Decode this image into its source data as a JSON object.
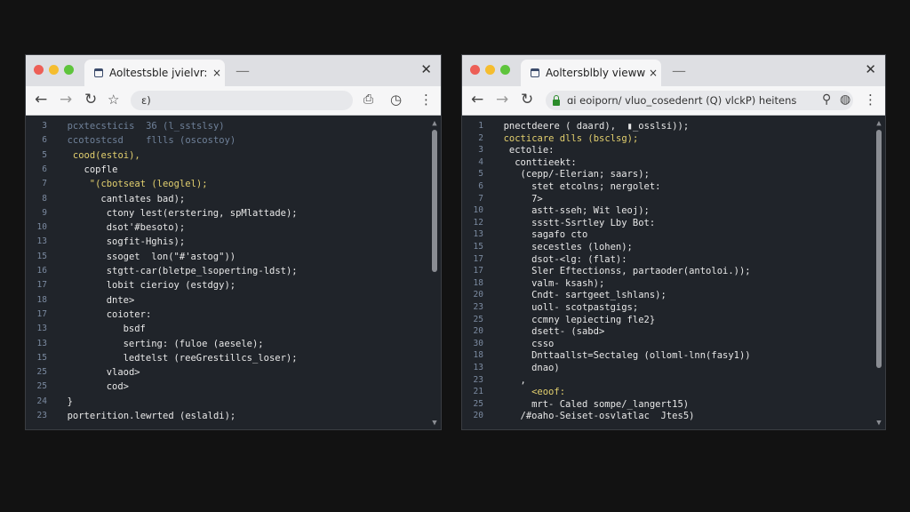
{
  "left": {
    "tab_title": "Aoltestsble jvielvr:",
    "tab_close": "×",
    "new_tab": "—",
    "window_close": "✕",
    "url": "ɛ)",
    "colors": {
      "code_text": "#e8e8e8",
      "line_number": "#7b8aa0",
      "accent_green": "#b7d36a",
      "accent_yellow": "#e2cf6e"
    },
    "lines": [
      {
        "num": "3",
        "text": "pcxtecsticis  36 (l_sstslsy)",
        "color": "dim",
        "indent": 2
      },
      {
        "num": "6",
        "text": "ccotostcsd    fllls (oscostoy)",
        "color": "dim",
        "indent": 2
      },
      {
        "num": "5",
        "text": "cood(estoi),",
        "color": "yellow",
        "indent": 3
      },
      {
        "num": "6",
        "text": "copfle",
        "color": "white",
        "indent": 5
      },
      {
        "num": "7",
        "text": "\"(cbotseat (leoglel);",
        "color": "yellow",
        "indent": 6
      },
      {
        "num": "8",
        "text": "cantlates bad);",
        "color": "white",
        "indent": 8
      },
      {
        "num": "9",
        "text": "ctony lest(erstering, spMlattade);",
        "color": "white",
        "indent": 9
      },
      {
        "num": "10",
        "text": "dsot'#besoto);",
        "color": "white",
        "indent": 9
      },
      {
        "num": "13",
        "text": "sogfit-Hghis);",
        "color": "white",
        "indent": 9
      },
      {
        "num": "15",
        "text": "ssoget  lon(\"#'astog\"))",
        "color": "white",
        "indent": 9
      },
      {
        "num": "16",
        "text": "stgtt-car(bletpe_lsoperting-ldst);",
        "color": "white",
        "indent": 9
      },
      {
        "num": "17",
        "text": "lobit cierioy (estdgy);",
        "color": "white",
        "indent": 9
      },
      {
        "num": "18",
        "text": "dnte>",
        "color": "white",
        "indent": 9
      },
      {
        "num": "17",
        "text": "coioter:",
        "color": "white",
        "indent": 9
      },
      {
        "num": "13",
        "text": "bsdf",
        "color": "white",
        "indent": 12
      },
      {
        "num": "13",
        "text": "serting: (fuloe (aesele);",
        "color": "white",
        "indent": 12
      },
      {
        "num": "15",
        "text": "ledtelst (reeGrestillcs_loser);",
        "color": "white",
        "indent": 12
      },
      {
        "num": "25",
        "text": "vlaod>",
        "color": "white",
        "indent": 9
      },
      {
        "num": "25",
        "text": "cod>",
        "color": "white",
        "indent": 9
      },
      {
        "num": "24",
        "text": "}",
        "color": "white",
        "indent": 2
      },
      {
        "num": "23",
        "text": "porterition.lewrted (eslaldi);",
        "color": "white",
        "indent": 2
      }
    ]
  },
  "right": {
    "tab_title": "Aoltersblbly vieww:",
    "tab_close": "×",
    "new_tab": "—",
    "window_close": "✕",
    "url": "ɑi eoiporn/ vluo_cosedenrt (Q) vlckP) heitens",
    "colors": {
      "code_text": "#e8e8e8",
      "line_number": "#7b8aa0",
      "accent_green": "#b7d36a",
      "accent_yellow": "#e2cf6e"
    },
    "lines": [
      {
        "num": "1",
        "text": "pnectdeere ( daard),  ▮_osslsi));",
        "color": "white",
        "indent": 2
      },
      {
        "num": "2",
        "text": "cocticare dlls (bsclsg);",
        "color": "yellow",
        "indent": 2
      },
      {
        "num": "3",
        "text": "ectolie:",
        "color": "white",
        "indent": 3
      },
      {
        "num": "4",
        "text": "conttieekt:",
        "color": "white",
        "indent": 4
      },
      {
        "num": "5",
        "text": "(cepp/-Elerian; saars);",
        "color": "white",
        "indent": 5
      },
      {
        "num": "6",
        "text": "stet etcolns; nergolet:",
        "color": "white",
        "indent": 7
      },
      {
        "num": "7",
        "text": "7>",
        "color": "white",
        "indent": 7
      },
      {
        "num": "10",
        "text": "astt-sseh; Wit leoj);",
        "color": "white",
        "indent": 7
      },
      {
        "num": "12",
        "text": "ssstt-Ssrtley Lby Bot:",
        "color": "white",
        "indent": 7
      },
      {
        "num": "13",
        "text": "sagafo cto",
        "color": "white",
        "indent": 7
      },
      {
        "num": "15",
        "text": "secestles (lohen);",
        "color": "white",
        "indent": 7
      },
      {
        "num": "17",
        "text": "dsot-<lg: (flat):",
        "color": "white",
        "indent": 7
      },
      {
        "num": "17",
        "text": "Sler Eftectionss, partaoder(antoloi.));",
        "color": "white",
        "indent": 7
      },
      {
        "num": "18",
        "text": "valm- ksash);",
        "color": "white",
        "indent": 7
      },
      {
        "num": "20",
        "text": "Cndt- sartgeet_lshlans);",
        "color": "white",
        "indent": 7
      },
      {
        "num": "23",
        "text": "uoll- scotpastgigs;",
        "color": "white",
        "indent": 7
      },
      {
        "num": "25",
        "text": "ccmny lepiecting fle2}",
        "color": "white",
        "indent": 7
      },
      {
        "num": "20",
        "text": "dsett- (sabd>",
        "color": "white",
        "indent": 7
      },
      {
        "num": "30",
        "text": "csso",
        "color": "white",
        "indent": 7
      },
      {
        "num": "18",
        "text": "Dnttaallst=Sectaleg (olloml-lnn(fasy1))",
        "color": "white",
        "indent": 7
      },
      {
        "num": "13",
        "text": "dnao)",
        "color": "white",
        "indent": 7
      },
      {
        "num": "23",
        "text": ",",
        "color": "white",
        "indent": 5
      },
      {
        "num": "21",
        "text": "<eoof:",
        "color": "yellow",
        "indent": 7
      },
      {
        "num": "25",
        "text": "mrt- Caled sompe/_langert15)",
        "color": "white",
        "indent": 7
      },
      {
        "num": "20",
        "text": "/#oaho-Seiset-osvlatlac  Jtes5)",
        "color": "white",
        "indent": 5
      }
    ]
  }
}
